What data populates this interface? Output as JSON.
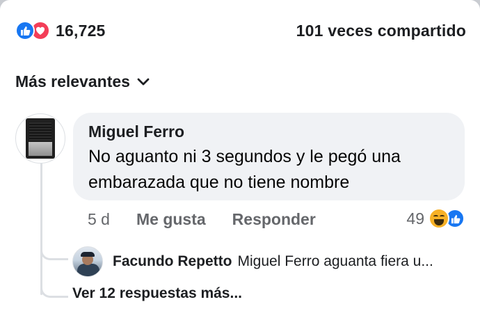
{
  "reactions": {
    "count": "16,725",
    "icons": [
      "like-icon",
      "love-icon"
    ],
    "like_color": "#1877f2",
    "love_color": "#f33e58"
  },
  "shares": {
    "label": "101 veces compartido"
  },
  "sort": {
    "label": "Más relevantes",
    "icon": "chevron-down-icon"
  },
  "comment": {
    "author": "Miguel Ferro",
    "text": "No aguanto ni 3 segundos y le pegó una embarazada que no tiene nombre",
    "time": "5 d",
    "like_label": "Me gusta",
    "reply_label": "Responder",
    "reaction_count": "49",
    "reaction_icons": [
      "haha-icon",
      "like-icon"
    ]
  },
  "reply": {
    "author": "Facundo Repetto",
    "snippet": "Miguel Ferro aguanta fiera u..."
  },
  "more_replies": {
    "label": "Ver 12 respuestas más..."
  },
  "colors": {
    "bubble_bg": "#f0f2f5",
    "secondary_text": "#65676b",
    "thread_line": "#dcdfe3"
  }
}
